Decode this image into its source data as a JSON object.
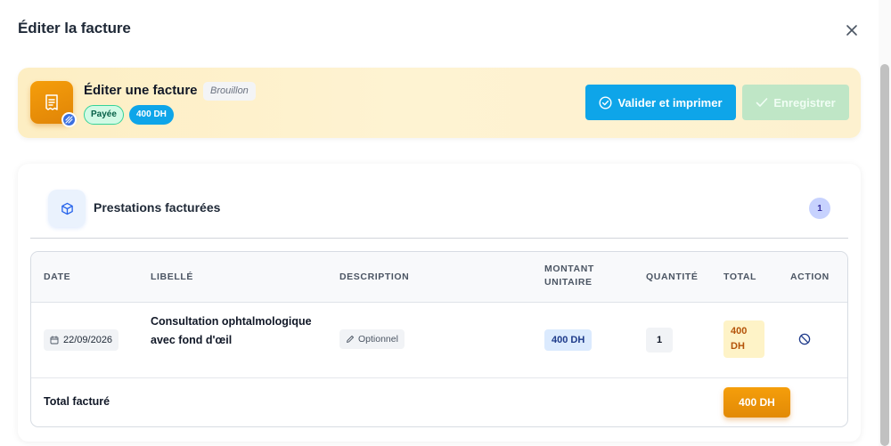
{
  "modal": {
    "title": "Éditer la facture"
  },
  "hero": {
    "title": "Éditer une facture",
    "status_draft": "Brouillon",
    "status_paid": "Payée",
    "amount": "400 DH",
    "validate_label": "Valider et imprimer",
    "save_label": "Enregistrer"
  },
  "section": {
    "title": "Prestations facturées",
    "count": "1"
  },
  "table": {
    "headers": {
      "date": "DATE",
      "libelle": "LIBELLÉ",
      "description": "DESCRIPTION",
      "unit_price_line1": "MONTANT",
      "unit_price_line2": "UNITAIRE",
      "quantity": "QUANTITÉ",
      "total": "TOTAL",
      "action": "ACTION"
    },
    "rows": [
      {
        "date": "22/09/2026",
        "libelle": "Consultation ophtalmologique avec fond d'œil",
        "description": "Optionnel",
        "unit_price": "400 DH",
        "quantity": "1",
        "total_line1": "400",
        "total_line2": "DH"
      }
    ],
    "footer": {
      "label": "Total facturé",
      "total": "400 DH"
    }
  },
  "colors": {
    "accent_blue": "#0ea5e9",
    "accent_orange": "#f59e0b",
    "success_green": "#bfe6c6"
  },
  "icons": {
    "close": "close-icon",
    "invoice": "receipt-icon",
    "edit_badge": "pencil-stripe-icon",
    "validate": "check-circle-icon",
    "save": "check-icon",
    "section": "cube-icon",
    "date": "calendar-icon",
    "description": "pencil-icon",
    "action": "ban-icon"
  }
}
